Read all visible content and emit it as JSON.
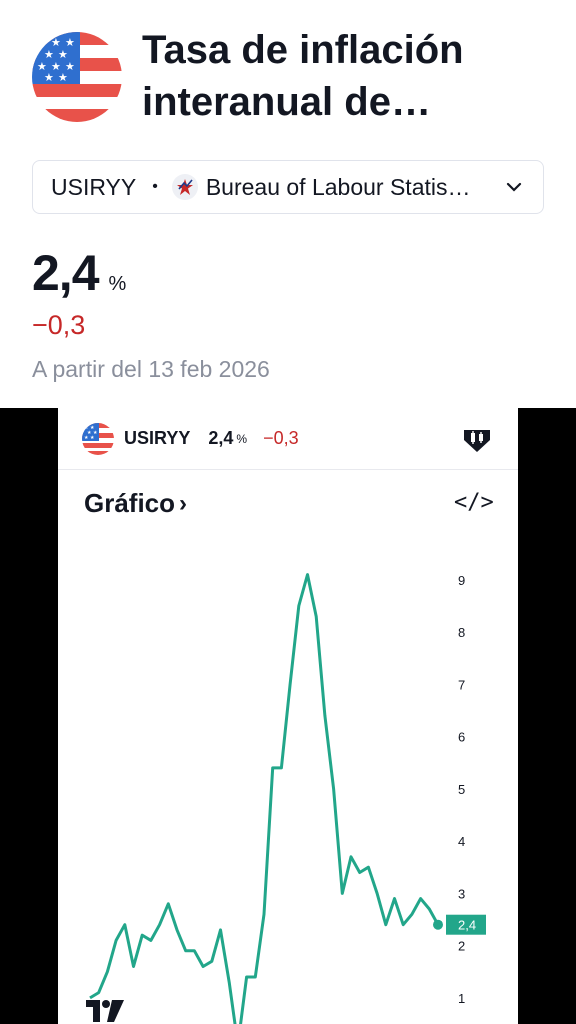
{
  "header": {
    "title_line1": "Tasa de inflación",
    "title_line2": "interanual de…",
    "flag_icon": "us-flag-icon"
  },
  "source": {
    "symbol": "USIRYY",
    "separator": "•",
    "provider": "Bureau of Labour Statis…",
    "provider_icon": "bls-logo-icon",
    "dropdown_icon": "chevron-down-icon"
  },
  "quote": {
    "value": "2,4",
    "unit": "%",
    "change": "−0,3",
    "as_of": "A partir del 13 feb 2026"
  },
  "widget": {
    "symbol": "USIRYY",
    "value": "2,4",
    "unit": "%",
    "change": "−0,3",
    "chart_link": "Gráfico",
    "chart_link_arrow": "›",
    "embed_icon": "</>",
    "colors": {
      "line": "#22a68a",
      "negative": "#c62828",
      "text": "#131722"
    }
  },
  "chart_data": {
    "type": "line",
    "title": "",
    "xlabel": "",
    "ylabel": "",
    "ylim": [
      0.5,
      9.8
    ],
    "yticks": [
      "9",
      "8",
      "7",
      "6",
      "5",
      "4",
      "3",
      "2",
      "1"
    ],
    "last_value_label": "2,4",
    "series": [
      {
        "values": [
          1.0,
          1.1,
          1.5,
          2.1,
          2.4,
          1.6,
          2.2,
          2.1,
          2.4,
          2.8,
          2.3,
          1.9,
          1.9,
          1.6,
          1.7,
          2.3,
          1.3,
          0.1,
          1.4,
          1.4,
          2.6,
          5.4,
          5.4,
          7.0,
          8.5,
          9.1,
          8.3,
          6.4,
          5.0,
          3.0,
          3.7,
          3.4,
          3.5,
          3.0,
          2.4,
          2.9,
          2.4,
          2.6,
          2.9,
          2.7,
          2.4
        ]
      }
    ]
  }
}
